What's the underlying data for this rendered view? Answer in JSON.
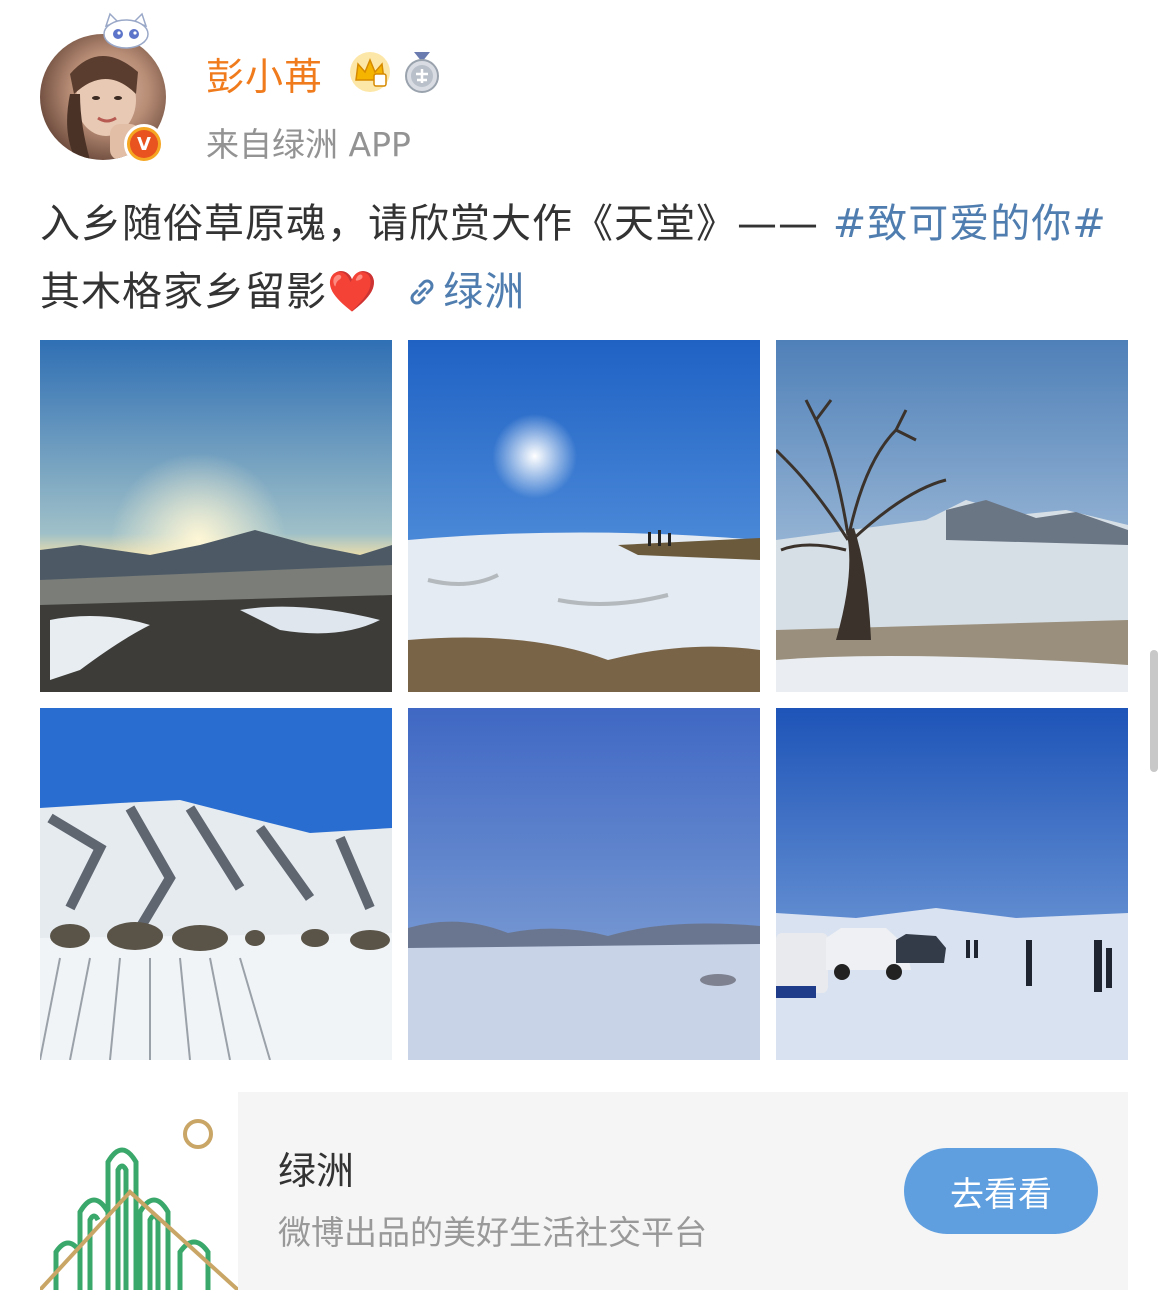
{
  "user": {
    "name": "彭小苒",
    "source": "来自绿洲 APP",
    "verified_mark": "V"
  },
  "post": {
    "text_main": "入乡随俗草原魂，请欣赏大作《天堂》—— ",
    "hashtag": "#致可爱的你#",
    "text_after": "  其木格家乡留影",
    "heart": "❤️",
    "link_label": "绿洲"
  },
  "photos": [
    {
      "name": "sunset-mountain-photo"
    },
    {
      "name": "sun-snow-hill-photo"
    },
    {
      "name": "lone-tree-photo"
    },
    {
      "name": "snowy-mountain-field-photo"
    },
    {
      "name": "snow-plain-photo"
    },
    {
      "name": "cars-on-snow-photo"
    }
  ],
  "card": {
    "title": "绿洲",
    "subtitle": "微博出品的美好生活社交平台",
    "button_label": "去看看"
  },
  "colors": {
    "username": "#f07b1d",
    "link": "#507daf",
    "button": "#5f9fe0"
  }
}
